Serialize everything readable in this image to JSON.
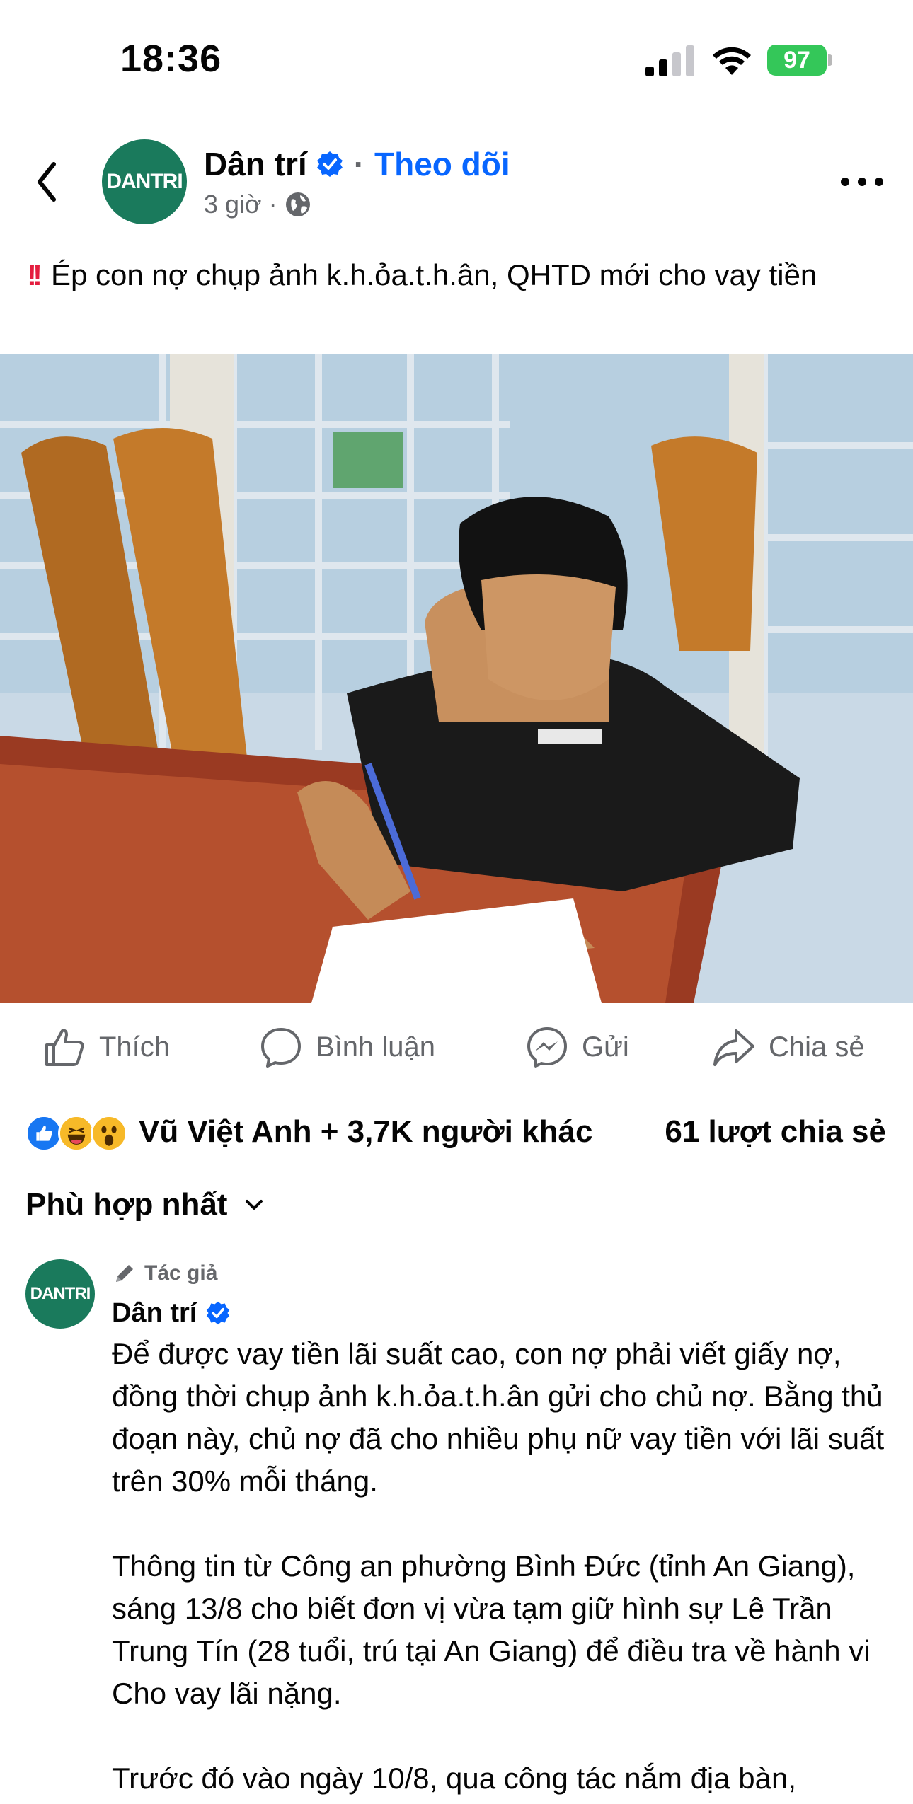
{
  "status_bar": {
    "time": "18:36",
    "battery": "97",
    "battery_color": "#34c759"
  },
  "post": {
    "page_name": "Dân trí",
    "avatar_text": "DANTRI",
    "follow_label": "Theo dõi",
    "time_ago": "3 giờ",
    "separator": "·",
    "caption_icon": "‼️ (double-exclamation-icon)",
    "caption": "Ép con nợ chụp ảnh k.h.ỏa.t.h.ân, QHTD mới cho vay tiền"
  },
  "actions": {
    "like": "Thích",
    "comment": "Bình luận",
    "send": "Gửi",
    "share": "Chia sẻ"
  },
  "reactions": {
    "icons": [
      "like-icon",
      "haha-icon",
      "wow-icon"
    ],
    "summary": "Vũ Việt Anh + 3,7K người khác",
    "shares": "61 lượt chia sẻ"
  },
  "comments": {
    "sort_label": "Phù hợp nhất",
    "items": [
      {
        "badge": "Tác giả",
        "author": "Dân trí",
        "avatar_text": "DANTRI",
        "paragraphs": [
          "Để được vay tiền lãi suất cao, con nợ phải viết giấy nợ, đồng thời chụp ảnh k.h.ỏa.t.h.ân gửi cho chủ nợ. Bằng thủ đoạn này, chủ nợ đã cho nhiều phụ nữ vay tiền với lãi suất trên 30% mỗi tháng.",
          "Thông tin từ Công an phường Bình Đức (tỉnh An Giang), sáng 13/8 cho biết đơn vị  vừa tạm giữ hình sự Lê Trần Trung Tín (28 tuổi, trú tại An Giang) để điều tra về hành vi Cho vay lãi nặng.",
          "Trước đó vào ngày 10/8, qua công tác nắm địa bàn,"
        ]
      }
    ]
  },
  "colors": {
    "brand_blue": "#0866ff",
    "secondary_text": "#65676b",
    "dantri_green": "#1a7a5c",
    "alert_red": "#e41e3f"
  }
}
